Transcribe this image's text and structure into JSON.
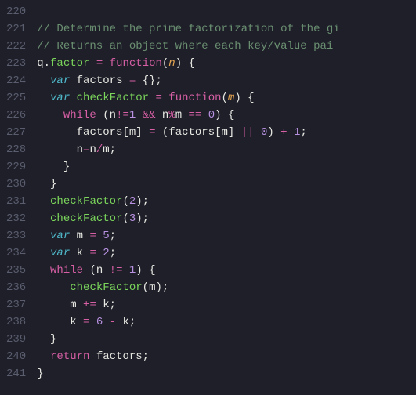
{
  "gutter": {
    "start": 220,
    "end": 241
  },
  "lines": {
    "220": [],
    "221": [
      {
        "c": "tok-comment",
        "t": "// Determine the prime factorization of the gi"
      }
    ],
    "222": [
      {
        "c": "tok-comment",
        "t": "// Returns an object where each key/value pai"
      }
    ],
    "223": [
      {
        "c": "tok-identifier",
        "t": "q"
      },
      {
        "c": "tok-punc",
        "t": "."
      },
      {
        "c": "tok-function",
        "t": "factor"
      },
      {
        "c": "tok-punc",
        "t": " "
      },
      {
        "c": "tok-operator",
        "t": "="
      },
      {
        "c": "tok-punc",
        "t": " "
      },
      {
        "c": "tok-keyword2",
        "t": "function"
      },
      {
        "c": "tok-paren",
        "t": "("
      },
      {
        "c": "tok-param",
        "t": "n"
      },
      {
        "c": "tok-paren",
        "t": ")"
      },
      {
        "c": "tok-punc",
        "t": " "
      },
      {
        "c": "tok-brace",
        "t": "{"
      }
    ],
    "224": [
      {
        "c": "",
        "t": "  "
      },
      {
        "c": "tok-keyword",
        "t": "var"
      },
      {
        "c": "tok-punc",
        "t": " "
      },
      {
        "c": "tok-identifier",
        "t": "factors"
      },
      {
        "c": "tok-punc",
        "t": " "
      },
      {
        "c": "tok-operator",
        "t": "="
      },
      {
        "c": "tok-punc",
        "t": " "
      },
      {
        "c": "tok-brace",
        "t": "{}"
      },
      {
        "c": "tok-punc",
        "t": ";"
      }
    ],
    "225": [
      {
        "c": "",
        "t": "  "
      },
      {
        "c": "tok-keyword",
        "t": "var"
      },
      {
        "c": "tok-punc",
        "t": " "
      },
      {
        "c": "tok-function",
        "t": "checkFactor"
      },
      {
        "c": "tok-punc",
        "t": " "
      },
      {
        "c": "tok-operator",
        "t": "="
      },
      {
        "c": "tok-punc",
        "t": " "
      },
      {
        "c": "tok-keyword2",
        "t": "function"
      },
      {
        "c": "tok-paren",
        "t": "("
      },
      {
        "c": "tok-param",
        "t": "m"
      },
      {
        "c": "tok-paren",
        "t": ")"
      },
      {
        "c": "tok-punc",
        "t": " "
      },
      {
        "c": "tok-brace",
        "t": "{"
      }
    ],
    "226": [
      {
        "c": "",
        "t": "    "
      },
      {
        "c": "tok-keyword2",
        "t": "while"
      },
      {
        "c": "tok-punc",
        "t": " "
      },
      {
        "c": "tok-paren",
        "t": "("
      },
      {
        "c": "tok-identifier",
        "t": "n"
      },
      {
        "c": "tok-operator",
        "t": "!="
      },
      {
        "c": "tok-number",
        "t": "1"
      },
      {
        "c": "tok-punc",
        "t": " "
      },
      {
        "c": "tok-operator",
        "t": "&&"
      },
      {
        "c": "tok-punc",
        "t": " "
      },
      {
        "c": "tok-identifier",
        "t": "n"
      },
      {
        "c": "tok-operator",
        "t": "%"
      },
      {
        "c": "tok-identifier",
        "t": "m"
      },
      {
        "c": "tok-punc",
        "t": " "
      },
      {
        "c": "tok-operator",
        "t": "=="
      },
      {
        "c": "tok-punc",
        "t": " "
      },
      {
        "c": "tok-number",
        "t": "0"
      },
      {
        "c": "tok-paren",
        "t": ")"
      },
      {
        "c": "tok-punc",
        "t": " "
      },
      {
        "c": "tok-brace",
        "t": "{"
      }
    ],
    "227": [
      {
        "c": "",
        "t": "      "
      },
      {
        "c": "tok-identifier",
        "t": "factors"
      },
      {
        "c": "tok-bracket",
        "t": "["
      },
      {
        "c": "tok-identifier",
        "t": "m"
      },
      {
        "c": "tok-bracket",
        "t": "]"
      },
      {
        "c": "tok-punc",
        "t": " "
      },
      {
        "c": "tok-operator",
        "t": "="
      },
      {
        "c": "tok-punc",
        "t": " "
      },
      {
        "c": "tok-paren",
        "t": "("
      },
      {
        "c": "tok-identifier",
        "t": "factors"
      },
      {
        "c": "tok-bracket",
        "t": "["
      },
      {
        "c": "tok-identifier",
        "t": "m"
      },
      {
        "c": "tok-bracket",
        "t": "]"
      },
      {
        "c": "tok-punc",
        "t": " "
      },
      {
        "c": "tok-operator",
        "t": "||"
      },
      {
        "c": "tok-punc",
        "t": " "
      },
      {
        "c": "tok-number",
        "t": "0"
      },
      {
        "c": "tok-paren",
        "t": ")"
      },
      {
        "c": "tok-punc",
        "t": " "
      },
      {
        "c": "tok-operator",
        "t": "+"
      },
      {
        "c": "tok-punc",
        "t": " "
      },
      {
        "c": "tok-number",
        "t": "1"
      },
      {
        "c": "tok-punc",
        "t": ";"
      }
    ],
    "228": [
      {
        "c": "",
        "t": "      "
      },
      {
        "c": "tok-identifier",
        "t": "n"
      },
      {
        "c": "tok-operator",
        "t": "="
      },
      {
        "c": "tok-identifier",
        "t": "n"
      },
      {
        "c": "tok-operator",
        "t": "/"
      },
      {
        "c": "tok-identifier",
        "t": "m"
      },
      {
        "c": "tok-punc",
        "t": ";"
      }
    ],
    "229": [
      {
        "c": "",
        "t": "    "
      },
      {
        "c": "tok-brace",
        "t": "}"
      }
    ],
    "230": [
      {
        "c": "",
        "t": "  "
      },
      {
        "c": "tok-brace",
        "t": "}"
      }
    ],
    "231": [
      {
        "c": "",
        "t": "  "
      },
      {
        "c": "tok-function",
        "t": "checkFactor"
      },
      {
        "c": "tok-paren",
        "t": "("
      },
      {
        "c": "tok-number",
        "t": "2"
      },
      {
        "c": "tok-paren",
        "t": ")"
      },
      {
        "c": "tok-punc",
        "t": ";"
      }
    ],
    "232": [
      {
        "c": "",
        "t": "  "
      },
      {
        "c": "tok-function",
        "t": "checkFactor"
      },
      {
        "c": "tok-paren",
        "t": "("
      },
      {
        "c": "tok-number",
        "t": "3"
      },
      {
        "c": "tok-paren",
        "t": ")"
      },
      {
        "c": "tok-punc",
        "t": ";"
      }
    ],
    "233": [
      {
        "c": "",
        "t": "  "
      },
      {
        "c": "tok-keyword",
        "t": "var"
      },
      {
        "c": "tok-punc",
        "t": " "
      },
      {
        "c": "tok-identifier",
        "t": "m"
      },
      {
        "c": "tok-punc",
        "t": " "
      },
      {
        "c": "tok-operator",
        "t": "="
      },
      {
        "c": "tok-punc",
        "t": " "
      },
      {
        "c": "tok-number",
        "t": "5"
      },
      {
        "c": "tok-punc",
        "t": ";"
      }
    ],
    "234": [
      {
        "c": "",
        "t": "  "
      },
      {
        "c": "tok-keyword",
        "t": "var"
      },
      {
        "c": "tok-punc",
        "t": " "
      },
      {
        "c": "tok-identifier",
        "t": "k"
      },
      {
        "c": "tok-punc",
        "t": " "
      },
      {
        "c": "tok-operator",
        "t": "="
      },
      {
        "c": "tok-punc",
        "t": " "
      },
      {
        "c": "tok-number",
        "t": "2"
      },
      {
        "c": "tok-punc",
        "t": ";"
      }
    ],
    "235": [
      {
        "c": "",
        "t": "  "
      },
      {
        "c": "tok-keyword2",
        "t": "while"
      },
      {
        "c": "tok-punc",
        "t": " "
      },
      {
        "c": "tok-paren",
        "t": "("
      },
      {
        "c": "tok-identifier",
        "t": "n"
      },
      {
        "c": "tok-punc",
        "t": " "
      },
      {
        "c": "tok-operator",
        "t": "!="
      },
      {
        "c": "tok-punc",
        "t": " "
      },
      {
        "c": "tok-number",
        "t": "1"
      },
      {
        "c": "tok-paren",
        "t": ")"
      },
      {
        "c": "tok-punc",
        "t": " "
      },
      {
        "c": "tok-brace",
        "t": "{"
      }
    ],
    "236": [
      {
        "c": "",
        "t": "     "
      },
      {
        "c": "tok-function",
        "t": "checkFactor"
      },
      {
        "c": "tok-paren",
        "t": "("
      },
      {
        "c": "tok-identifier",
        "t": "m"
      },
      {
        "c": "tok-paren",
        "t": ")"
      },
      {
        "c": "tok-punc",
        "t": ";"
      }
    ],
    "237": [
      {
        "c": "",
        "t": "     "
      },
      {
        "c": "tok-identifier",
        "t": "m"
      },
      {
        "c": "tok-punc",
        "t": " "
      },
      {
        "c": "tok-operator",
        "t": "+="
      },
      {
        "c": "tok-punc",
        "t": " "
      },
      {
        "c": "tok-identifier",
        "t": "k"
      },
      {
        "c": "tok-punc",
        "t": ";"
      }
    ],
    "238": [
      {
        "c": "",
        "t": "     "
      },
      {
        "c": "tok-identifier",
        "t": "k"
      },
      {
        "c": "tok-punc",
        "t": " "
      },
      {
        "c": "tok-operator",
        "t": "="
      },
      {
        "c": "tok-punc",
        "t": " "
      },
      {
        "c": "tok-number",
        "t": "6"
      },
      {
        "c": "tok-punc",
        "t": " "
      },
      {
        "c": "tok-operator",
        "t": "-"
      },
      {
        "c": "tok-punc",
        "t": " "
      },
      {
        "c": "tok-identifier",
        "t": "k"
      },
      {
        "c": "tok-punc",
        "t": ";"
      }
    ],
    "239": [
      {
        "c": "",
        "t": "  "
      },
      {
        "c": "tok-brace",
        "t": "}"
      }
    ],
    "240": [
      {
        "c": "",
        "t": "  "
      },
      {
        "c": "tok-keyword2",
        "t": "return"
      },
      {
        "c": "tok-punc",
        "t": " "
      },
      {
        "c": "tok-identifier",
        "t": "factors"
      },
      {
        "c": "tok-punc",
        "t": ";"
      }
    ],
    "241": [
      {
        "c": "tok-brace",
        "t": "}"
      }
    ]
  }
}
